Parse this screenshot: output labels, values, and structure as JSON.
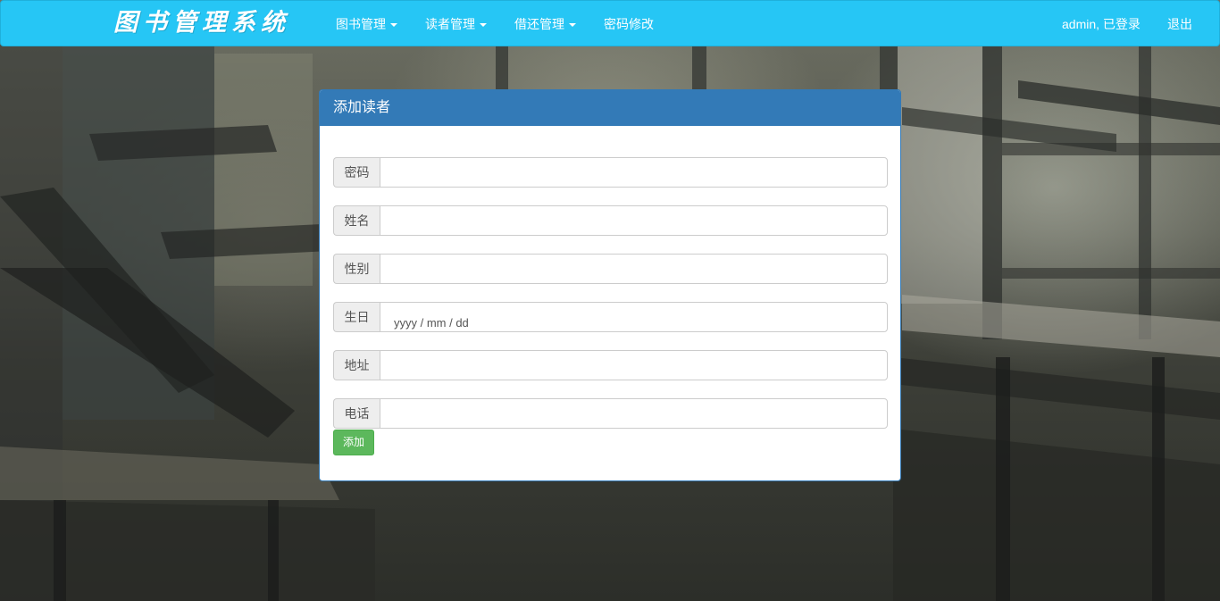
{
  "navbar": {
    "brand": "图书管理系统",
    "menu": [
      {
        "label": "图书管理",
        "has_dropdown": true
      },
      {
        "label": "读者管理",
        "has_dropdown": true
      },
      {
        "label": "借还管理",
        "has_dropdown": true
      },
      {
        "label": "密码修改",
        "has_dropdown": false
      }
    ],
    "user_status": "admin, 已登录",
    "logout": "退出",
    "color": "#26c6f5"
  },
  "form": {
    "title": "添加读者",
    "header_color": "#337ab7",
    "fields": [
      {
        "label": "密码",
        "value": ""
      },
      {
        "label": "姓名",
        "value": ""
      },
      {
        "label": "性别",
        "value": ""
      },
      {
        "label": "生日",
        "value": "",
        "placeholder": "yyyy / mm / dd"
      },
      {
        "label": "地址",
        "value": ""
      },
      {
        "label": "电话",
        "value": ""
      }
    ],
    "submit_label": "添加",
    "submit_color": "#5cb85c"
  },
  "background": {
    "icon": "classroom-photo"
  }
}
